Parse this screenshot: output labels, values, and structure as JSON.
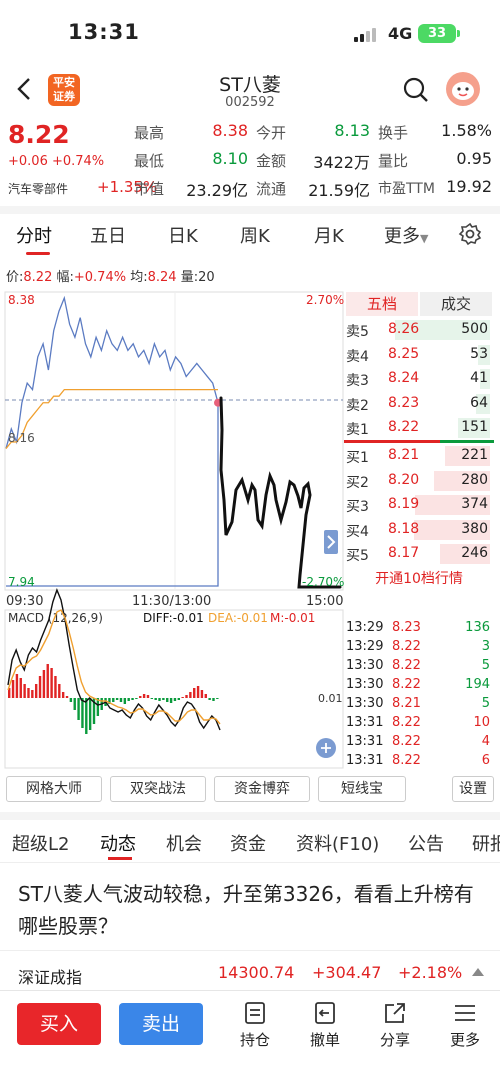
{
  "status": {
    "time": "13:31",
    "network": "4G",
    "battery": "33"
  },
  "header": {
    "logo_line1": "平安",
    "logo_line2": "证券",
    "name": "ST八菱",
    "code": "002592"
  },
  "quote": {
    "price": "8.22",
    "change": "+0.06 +0.74%",
    "sector": "汽车零部件",
    "sector_change": "+1.35%",
    "rows": [
      [
        {
          "label": "最高",
          "value": "8.38",
          "color": "red"
        },
        {
          "label": "今开",
          "value": "8.13",
          "color": "green"
        },
        {
          "label": "换手",
          "value": "1.58%",
          "color": "black"
        }
      ],
      [
        {
          "label": "最低",
          "value": "8.10",
          "color": "green"
        },
        {
          "label": "金额",
          "value": "3422万",
          "color": "black"
        },
        {
          "label": "量比",
          "value": "0.95",
          "color": "black"
        }
      ],
      [
        {
          "label": "市值",
          "value": "23.29亿",
          "color": "black"
        },
        {
          "label": "流通",
          "value": "21.59亿",
          "color": "black"
        },
        {
          "label": "市盈TTM",
          "value": "19.92",
          "color": "black"
        }
      ]
    ]
  },
  "chart_tabs": [
    "分时",
    "五日",
    "日K",
    "周K",
    "月K",
    "更多"
  ],
  "info": {
    "price_label": "价:",
    "price": "8.22",
    "amp_label": "幅:",
    "amp": "+0.74%",
    "avg_label": "均:",
    "avg": "8.24",
    "vol_label": "量:",
    "vol": "20"
  },
  "chart_labels": {
    "top_price": "8.38",
    "top_pct": "2.70%",
    "bottom_price": "7.94",
    "bottom_pct": "-2.70%",
    "mid_price": "8.16",
    "t_start": "09:30",
    "t_mid": "11:30/13:00",
    "t_end": "15:00",
    "macd_name": "MACD (12,26,9)",
    "diff": "DIFF:-0.01",
    "dea": "DEA:-0.01",
    "m": "M:-0.01",
    "macd_axis": "0.01"
  },
  "chart_data": {
    "type": "line",
    "title": "",
    "ylim": [
      7.94,
      8.38
    ],
    "series": [
      {
        "name": "价",
        "values": [
          8.15,
          8.18,
          8.16,
          8.22,
          8.25,
          8.24,
          8.29,
          8.31,
          8.27,
          8.33,
          8.36,
          8.38,
          8.34,
          8.32,
          8.35,
          8.31,
          8.29,
          8.32,
          8.3,
          8.33,
          8.31,
          8.3,
          8.32,
          8.3,
          8.31,
          8.29,
          8.3,
          8.28,
          8.31,
          8.29,
          8.3,
          8.27,
          8.29,
          8.28,
          8.26,
          8.27,
          8.28,
          8.27,
          8.26,
          8.25,
          8.22
        ]
      },
      {
        "name": "均",
        "values": [
          8.15,
          8.16,
          8.16,
          8.17,
          8.19,
          8.2,
          8.21,
          8.22,
          8.22,
          8.23,
          8.23,
          8.24,
          8.24,
          8.24,
          8.24,
          8.24,
          8.24,
          8.24,
          8.24,
          8.24,
          8.24,
          8.24,
          8.24,
          8.24,
          8.24,
          8.24,
          8.24,
          8.24,
          8.24,
          8.24,
          8.24,
          8.24,
          8.24,
          8.24,
          8.24,
          8.24,
          8.24,
          8.24,
          8.24,
          8.24,
          8.24
        ]
      }
    ]
  },
  "order_book": {
    "tab_left": "五档",
    "tab_right": "成交",
    "asks": [
      {
        "label": "卖5",
        "price": "8.26",
        "vol": "500",
        "bar": 0.95
      },
      {
        "label": "卖4",
        "price": "8.25",
        "vol": "53",
        "bar": 0.12
      },
      {
        "label": "卖3",
        "price": "8.24",
        "vol": "41",
        "bar": 0.1
      },
      {
        "label": "卖2",
        "price": "8.23",
        "vol": "64",
        "bar": 0.14
      },
      {
        "label": "卖1",
        "price": "8.22",
        "vol": "151",
        "bar": 0.32
      }
    ],
    "bids": [
      {
        "label": "买1",
        "price": "8.21",
        "vol": "221",
        "bar": 0.45
      },
      {
        "label": "买2",
        "price": "8.20",
        "vol": "280",
        "bar": 0.56
      },
      {
        "label": "买3",
        "price": "8.19",
        "vol": "374",
        "bar": 0.75
      },
      {
        "label": "买4",
        "price": "8.18",
        "vol": "380",
        "bar": 0.76
      },
      {
        "label": "买5",
        "price": "8.17",
        "vol": "246",
        "bar": 0.5
      }
    ],
    "link": "开通10档行情"
  },
  "ticks": [
    {
      "time": "13:29",
      "price": "8.23",
      "vol": "136",
      "pc": "red",
      "vc": "green"
    },
    {
      "time": "13:29",
      "price": "8.22",
      "vol": "3",
      "pc": "red",
      "vc": "green"
    },
    {
      "time": "13:30",
      "price": "8.22",
      "vol": "5",
      "pc": "red",
      "vc": "green"
    },
    {
      "time": "13:30",
      "price": "8.22",
      "vol": "194",
      "pc": "red",
      "vc": "green"
    },
    {
      "time": "13:30",
      "price": "8.21",
      "vol": "5",
      "pc": "red",
      "vc": "green"
    },
    {
      "time": "13:31",
      "price": "8.22",
      "vol": "10",
      "pc": "red",
      "vc": "red"
    },
    {
      "time": "13:31",
      "price": "8.22",
      "vol": "4",
      "pc": "red",
      "vc": "red"
    },
    {
      "time": "13:31",
      "price": "8.22",
      "vol": "6",
      "pc": "red",
      "vc": "red"
    }
  ],
  "tools": [
    "网格大师",
    "双突战法",
    "资金博弈",
    "短线宝",
    "设置"
  ],
  "section_tabs": [
    "超级L2",
    "动态",
    "机会",
    "资金",
    "资料(F10)",
    "公告",
    "研报"
  ],
  "news": "ST八菱人气波动较稳，升至第3326，看看上升榜有哪些股票？",
  "index": {
    "name": "深证成指",
    "value": "14300.74",
    "change": "+304.47",
    "pct": "+2.18%"
  },
  "bottom": {
    "buy": "买入",
    "sell": "卖出",
    "nav": [
      "持仓",
      "撤单",
      "分享",
      "更多"
    ]
  }
}
